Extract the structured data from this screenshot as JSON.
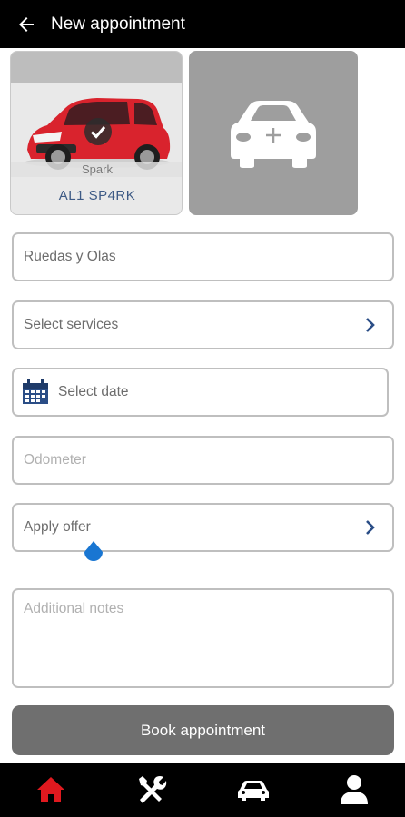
{
  "header": {
    "title": "New appointment",
    "back_icon": "back-arrow-icon"
  },
  "vehicle": {
    "model": "Spark",
    "plate": "AL1 SP4RK",
    "selected_icon": "check-circle-icon",
    "body_color": "#d9232d"
  },
  "add_vehicle": {
    "icon": "add-car-icon"
  },
  "form": {
    "workshop": {
      "value": "Ruedas y Olas"
    },
    "services": {
      "placeholder": "Select services"
    },
    "date": {
      "placeholder": "Select date"
    },
    "odometer": {
      "placeholder": "Odometer"
    },
    "offer": {
      "placeholder": "Apply offer"
    },
    "notes": {
      "placeholder": "Additional notes"
    }
  },
  "book_button": {
    "label": "Book appointment"
  },
  "bottom_nav": [
    {
      "name": "home",
      "icon": "home-icon",
      "active": true
    },
    {
      "name": "services",
      "icon": "tools-icon",
      "active": false
    },
    {
      "name": "vehicles",
      "icon": "car-icon",
      "active": false
    },
    {
      "name": "profile",
      "icon": "user-icon",
      "active": false
    }
  ],
  "colors": {
    "accent": "#e0191f",
    "link": "#2a4d86",
    "disabled_button": "#6f6f6f",
    "bar": "#000000"
  }
}
